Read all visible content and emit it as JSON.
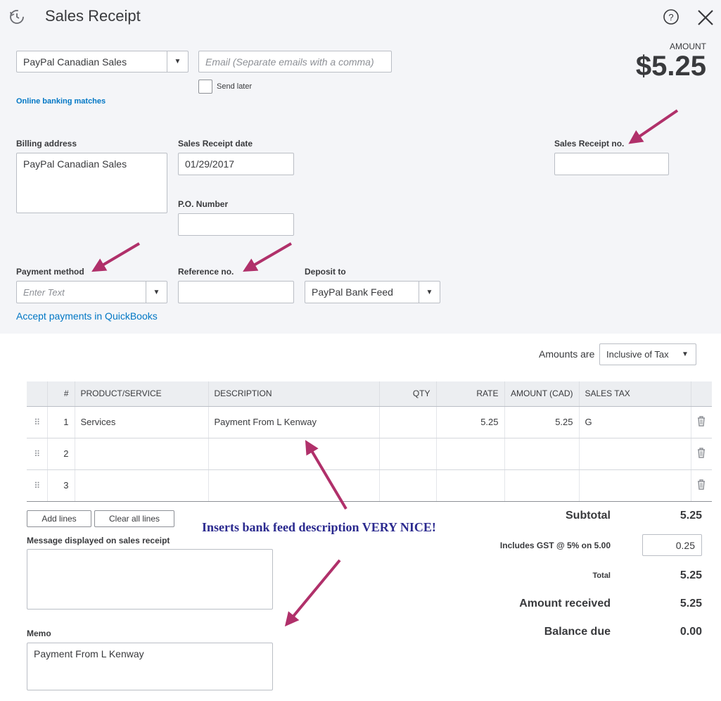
{
  "header": {
    "title": "Sales Receipt",
    "amount_label": "AMOUNT",
    "amount_value": "$5.25"
  },
  "customer": {
    "value": "PayPal Canadian Sales"
  },
  "email": {
    "placeholder": "Email (Separate emails with a comma)"
  },
  "send_later": {
    "label": "Send later"
  },
  "online_banking_link": "Online banking matches",
  "billing_address": {
    "label": "Billing address",
    "value": "PayPal Canadian Sales"
  },
  "sales_receipt_date": {
    "label": "Sales Receipt date",
    "value": "01/29/2017"
  },
  "po_number": {
    "label": "P.O. Number",
    "value": ""
  },
  "sales_receipt_no": {
    "label": "Sales Receipt no.",
    "value": ""
  },
  "payment_method": {
    "label": "Payment method",
    "placeholder": "Enter Text"
  },
  "reference_no": {
    "label": "Reference no.",
    "value": ""
  },
  "deposit_to": {
    "label": "Deposit to",
    "value": "PayPal Bank Feed"
  },
  "accept_payments_link": "Accept payments in QuickBooks",
  "amounts_are": {
    "label": "Amounts are",
    "value": "Inclusive of Tax"
  },
  "table": {
    "headers": [
      "#",
      "PRODUCT/SERVICE",
      "DESCRIPTION",
      "QTY",
      "RATE",
      "AMOUNT (CAD)",
      "SALES TAX"
    ],
    "rows": [
      {
        "num": "1",
        "product": "Services",
        "description": "Payment From L Kenway",
        "qty": "",
        "rate": "5.25",
        "amount": "5.25",
        "tax": "G"
      },
      {
        "num": "2",
        "product": "",
        "description": "",
        "qty": "",
        "rate": "",
        "amount": "",
        "tax": ""
      },
      {
        "num": "3",
        "product": "",
        "description": "",
        "qty": "",
        "rate": "",
        "amount": "",
        "tax": ""
      }
    ]
  },
  "buttons": {
    "add_lines": "Add lines",
    "clear_all_lines": "Clear all lines"
  },
  "message": {
    "label": "Message displayed on sales receipt",
    "value": ""
  },
  "memo": {
    "label": "Memo",
    "value": "Payment From L Kenway"
  },
  "totals": {
    "subtotal_label": "Subtotal",
    "subtotal_value": "5.25",
    "gst_label": "Includes GST @ 5% on 5.00",
    "gst_value": "0.25",
    "total_label": "Total",
    "total_value": "5.25",
    "amount_received_label": "Amount received",
    "amount_received_value": "5.25",
    "balance_due_label": "Balance due",
    "balance_due_value": "0.00"
  },
  "annotation": "Inserts bank feed description VERY NICE!",
  "colors": {
    "arrow": "#b0306a",
    "link": "#0077c5",
    "annotation": "#2b2a8f"
  },
  "icons": [
    "history-icon",
    "help-icon",
    "close-icon",
    "chevron-down-icon",
    "drag-handle-icon",
    "trash-icon"
  ]
}
